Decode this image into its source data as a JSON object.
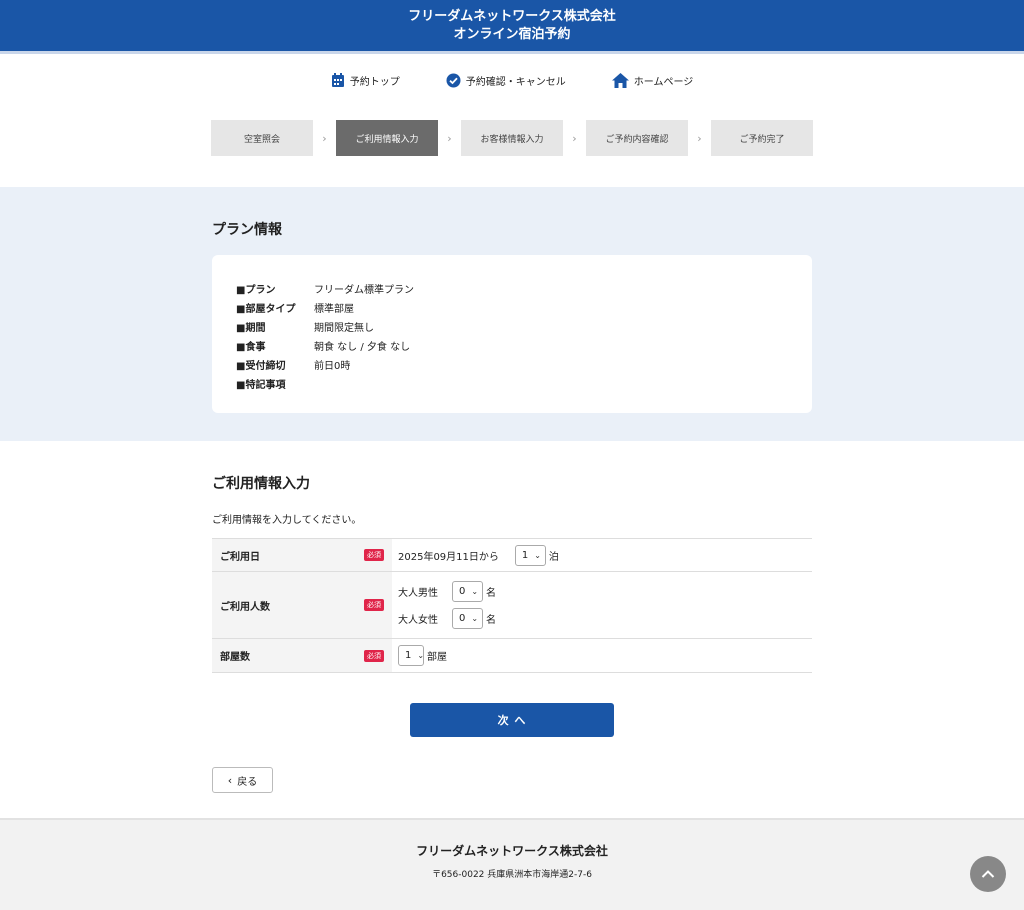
{
  "header": {
    "line1": "フリーダムネットワークス株式会社",
    "line2": "オンライン宿泊予約"
  },
  "topnav": {
    "items": [
      {
        "label": "予約トップ",
        "icon": "calendar-icon"
      },
      {
        "label": "予約確認・キャンセル",
        "icon": "check-circle-icon"
      },
      {
        "label": "ホームページ",
        "icon": "home-icon"
      }
    ]
  },
  "steps": {
    "items": [
      "空室照会",
      "ご利用情報入力",
      "お客様情報入力",
      "ご予約内容確認",
      "ご予約完了"
    ],
    "active": 1
  },
  "plan": {
    "title": "プラン情報",
    "rows": [
      {
        "label": "■プラン",
        "value": "フリーダム標準プラン"
      },
      {
        "label": "■部屋タイプ",
        "value": "標準部屋"
      },
      {
        "label": "■期間",
        "value": "期間限定無し"
      },
      {
        "label": "■食事",
        "value": "朝食 なし / 夕食 なし"
      },
      {
        "label": "■受付締切",
        "value": "前日0時"
      },
      {
        "label": "■特記事項",
        "value": ""
      }
    ]
  },
  "usage": {
    "title": "ご利用情報入力",
    "desc": "ご利用情報を入力してください。",
    "required": "必須",
    "date": {
      "label": "ご利用日",
      "text": "2025年09月11日から",
      "nights": "1",
      "unit": "泊"
    },
    "people": {
      "label": "ご利用人数",
      "male_label": "大人男性",
      "male": "0",
      "female_label": "大人女性",
      "female": "0",
      "unit": "名"
    },
    "rooms": {
      "label": "部屋数",
      "value": "1",
      "unit": "部屋"
    },
    "next": "次 へ",
    "back": "戻る"
  },
  "footer": {
    "company": "フリーダムネットワークス株式会社",
    "address": "〒656-0022 兵庫県洲本市海岸通2-7-6"
  },
  "colors": {
    "primary": "#1a56a7",
    "required": "#e0254a",
    "plan_bg": "#eaf0f8"
  }
}
